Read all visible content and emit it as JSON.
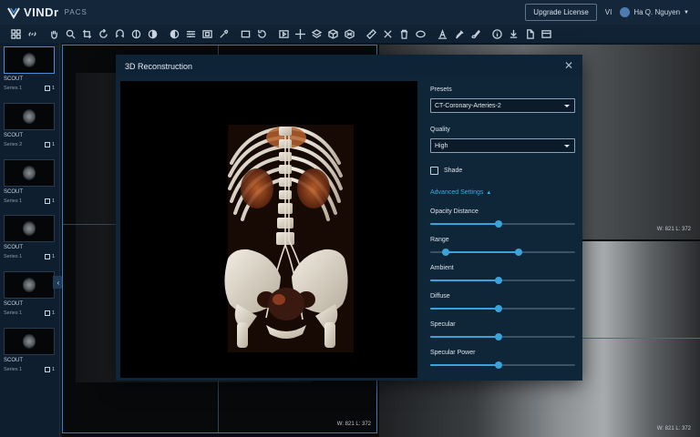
{
  "header": {
    "logo_text": "VINDr",
    "logo_sub": "PACS",
    "upgrade_label": "Upgrade License",
    "language": "VI",
    "user_name": "Ha Q. Nguyen"
  },
  "toolbar": {
    "icons": [
      "grid-icon",
      "link-icon",
      "pan-icon",
      "zoom-icon",
      "crop-icon",
      "rotate-icon",
      "magnet-icon",
      "invert-icon",
      "contrast-icon",
      "flip-icon",
      "sliders-icon",
      "window-icon",
      "eyedropper-icon",
      "rect-icon",
      "reset-icon",
      "play-icon",
      "crosshair-icon",
      "layers-icon",
      "cube-icon",
      "cube-3d-icon",
      "ruler-icon",
      "angle-icon",
      "trash-icon",
      "ellipse-icon",
      "text-icon",
      "marker-icon",
      "brush-icon",
      "info-icon",
      "download-icon",
      "file-icon",
      "layout-icon"
    ]
  },
  "sidebar": {
    "series": [
      {
        "title": "SCOUT",
        "sub": "Series 1",
        "count": "1"
      },
      {
        "title": "SCOUT",
        "sub": "Series 2",
        "count": "1"
      },
      {
        "title": "SCOUT",
        "sub": "Series 1",
        "count": "1"
      },
      {
        "title": "SCOUT",
        "sub": "Series 1",
        "count": "1"
      },
      {
        "title": "SCOUT",
        "sub": "Series 1",
        "count": "1"
      },
      {
        "title": "SCOUT",
        "sub": "Series 1",
        "count": "1"
      }
    ]
  },
  "viewports": {
    "wl_left": "W: 821 L: 372",
    "wl_tr": "W: 821 L: 372",
    "wl_br": "W: 821 L: 372"
  },
  "modal": {
    "title": "3D Reconstruction",
    "presets_label": "Presets",
    "presets_value": "CT-Coronary-Arteries-2",
    "quality_label": "Quality",
    "quality_value": "High",
    "shade_label": "Shade",
    "shade_checked": false,
    "advanced_label": "Advanced Settings",
    "sliders": [
      {
        "label": "Opacity Distance",
        "values": [
          0.47
        ]
      },
      {
        "label": "Range",
        "values": [
          0.11,
          0.61
        ]
      },
      {
        "label": "Ambient",
        "values": [
          0.47
        ]
      },
      {
        "label": "Diffuse",
        "values": [
          0.47
        ]
      },
      {
        "label": "Specular",
        "values": [
          0.47
        ]
      },
      {
        "label": "Specular Power",
        "values": [
          0.47
        ]
      }
    ]
  },
  "colors": {
    "accent": "#3aa3dc",
    "header_bg": "#13263a",
    "modal_bg": "#0f2538"
  }
}
